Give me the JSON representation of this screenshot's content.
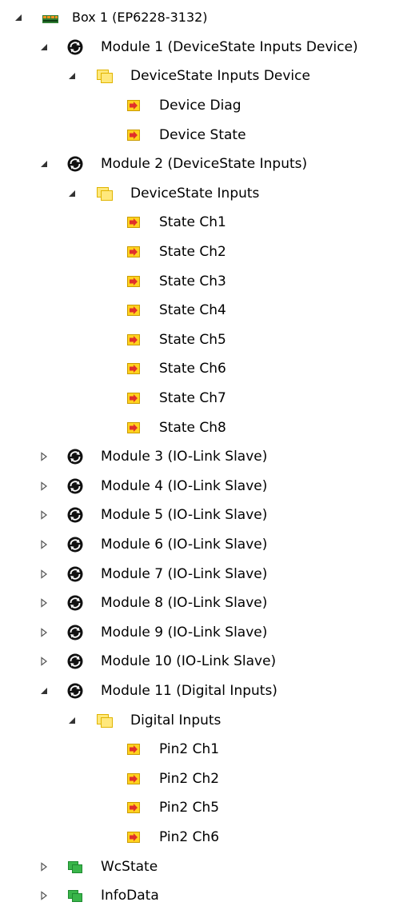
{
  "tree": {
    "nodes": [
      {
        "label": "Box 1 (EP6228-3132)",
        "level": 0,
        "state": "expanded",
        "icon": "box-icon"
      },
      {
        "label": "Module 1 (DeviceState Inputs Device)",
        "level": 1,
        "state": "expanded",
        "icon": "module-icon"
      },
      {
        "label": "DeviceState Inputs Device",
        "level": 2,
        "state": "expanded",
        "icon": "folder-icon"
      },
      {
        "label": "Device Diag",
        "level": 3,
        "state": "leaf",
        "icon": "input-variable-icon"
      },
      {
        "label": "Device State",
        "level": 3,
        "state": "leaf",
        "icon": "input-variable-icon"
      },
      {
        "label": "Module 2 (DeviceState Inputs)",
        "level": 1,
        "state": "expanded",
        "icon": "module-icon"
      },
      {
        "label": "DeviceState Inputs",
        "level": 2,
        "state": "expanded",
        "icon": "folder-icon"
      },
      {
        "label": "State Ch1",
        "level": 3,
        "state": "leaf",
        "icon": "input-variable-icon"
      },
      {
        "label": "State Ch2",
        "level": 3,
        "state": "leaf",
        "icon": "input-variable-icon"
      },
      {
        "label": "State Ch3",
        "level": 3,
        "state": "leaf",
        "icon": "input-variable-icon"
      },
      {
        "label": "State Ch4",
        "level": 3,
        "state": "leaf",
        "icon": "input-variable-icon"
      },
      {
        "label": "State Ch5",
        "level": 3,
        "state": "leaf",
        "icon": "input-variable-icon"
      },
      {
        "label": "State Ch6",
        "level": 3,
        "state": "leaf",
        "icon": "input-variable-icon"
      },
      {
        "label": "State Ch7",
        "level": 3,
        "state": "leaf",
        "icon": "input-variable-icon"
      },
      {
        "label": "State Ch8",
        "level": 3,
        "state": "leaf",
        "icon": "input-variable-icon"
      },
      {
        "label": "Module 3 (IO-Link Slave)",
        "level": 1,
        "state": "collapsed",
        "icon": "module-icon"
      },
      {
        "label": "Module 4 (IO-Link Slave)",
        "level": 1,
        "state": "collapsed",
        "icon": "module-icon"
      },
      {
        "label": "Module 5 (IO-Link Slave)",
        "level": 1,
        "state": "collapsed",
        "icon": "module-icon"
      },
      {
        "label": "Module 6 (IO-Link Slave)",
        "level": 1,
        "state": "collapsed",
        "icon": "module-icon"
      },
      {
        "label": "Module 7 (IO-Link Slave)",
        "level": 1,
        "state": "collapsed",
        "icon": "module-icon"
      },
      {
        "label": "Module 8 (IO-Link Slave)",
        "level": 1,
        "state": "collapsed",
        "icon": "module-icon"
      },
      {
        "label": "Module 9 (IO-Link Slave)",
        "level": 1,
        "state": "collapsed",
        "icon": "module-icon"
      },
      {
        "label": "Module 10 (IO-Link Slave)",
        "level": 1,
        "state": "collapsed",
        "icon": "module-icon"
      },
      {
        "label": "Module 11 (Digital Inputs)",
        "level": 1,
        "state": "expanded",
        "icon": "module-icon"
      },
      {
        "label": "Digital Inputs",
        "level": 2,
        "state": "expanded",
        "icon": "folder-icon"
      },
      {
        "label": "Pin2 Ch1",
        "level": 3,
        "state": "leaf",
        "icon": "input-variable-icon"
      },
      {
        "label": "Pin2 Ch2",
        "level": 3,
        "state": "leaf",
        "icon": "input-variable-icon"
      },
      {
        "label": "Pin2 Ch5",
        "level": 3,
        "state": "leaf",
        "icon": "input-variable-icon"
      },
      {
        "label": "Pin2 Ch6",
        "level": 3,
        "state": "leaf",
        "icon": "input-variable-icon"
      },
      {
        "label": "WcState",
        "level": 1,
        "state": "collapsed",
        "icon": "green-block-icon"
      },
      {
        "label": "InfoData",
        "level": 1,
        "state": "collapsed",
        "icon": "green-block-icon"
      }
    ]
  },
  "colors": {
    "folder_fill": "#ffe87c",
    "folder_border": "#e0b400",
    "variable_fill": "#ffd21f",
    "variable_arrow": "#e0302a",
    "green_block": "#39b54a",
    "green_block_dark": "#1e8a30",
    "box_orange": "#f7941d",
    "box_green": "#2e7d32",
    "toggle_arrow": "#333333"
  }
}
